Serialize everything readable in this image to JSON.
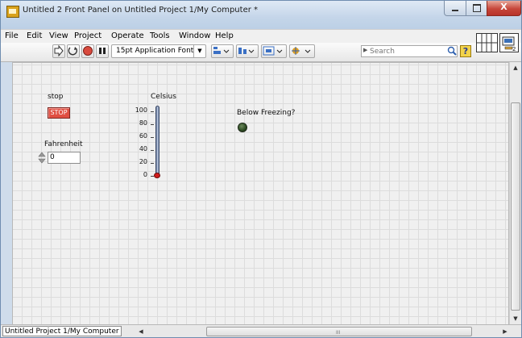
{
  "window": {
    "title": "Untitled 2 Front Panel on Untitled Project 1/My Computer *",
    "icon": "labview-vi-icon",
    "controls": {
      "close_label": "X"
    }
  },
  "menubar": {
    "items": [
      {
        "label": "File"
      },
      {
        "label": "Edit"
      },
      {
        "label": "View"
      },
      {
        "label": "Project"
      },
      {
        "label": "Operate"
      },
      {
        "label": "Tools"
      },
      {
        "label": "Window"
      },
      {
        "label": "Help"
      }
    ]
  },
  "toolbar": {
    "run_icon": "run-arrow-icon",
    "run_continuous_icon": "run-continuously-icon",
    "abort_icon": "abort-execution-icon",
    "pause_icon": "pause-icon",
    "font_ring": "15pt Application Font",
    "align_icon": "align-objects-icon",
    "distribute_icon": "distribute-objects-icon",
    "resize_icon": "resize-objects-icon",
    "reorder_icon": "reorder-icon",
    "search_placeholder": "Search",
    "help_label": "?"
  },
  "panel": {
    "stop": {
      "caption": "stop",
      "button_text": "STOP"
    },
    "fahrenheit": {
      "caption": "Fahrenheit",
      "value": "0"
    },
    "celsius": {
      "caption": "Celsius",
      "scale": [
        "100",
        "80",
        "60",
        "40",
        "20",
        "0"
      ],
      "value": 0
    },
    "below_freezing": {
      "caption": "Below Freezing?",
      "state": "off"
    }
  },
  "statusbar": {
    "context": "Untitled Project 1/My Computer",
    "hscroll_grip": "III"
  },
  "colors": {
    "stop_button": "#e04f42",
    "led_off": "#2c4a22",
    "thermometer_fill": "#d11d1d"
  }
}
